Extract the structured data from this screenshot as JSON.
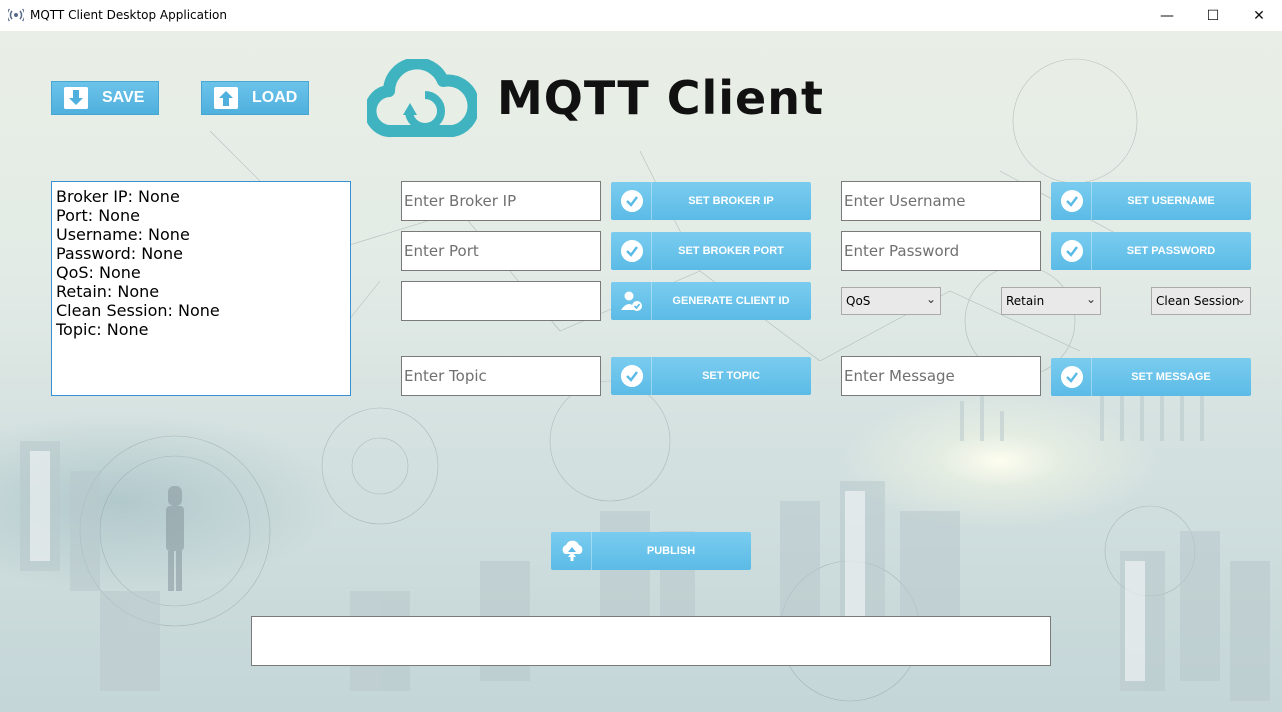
{
  "window": {
    "title": "MQTT Client Desktop Application",
    "minimize": "—",
    "maximize": "☐",
    "close": "✕"
  },
  "header": {
    "save_label": "SAVE",
    "load_label": "LOAD",
    "logo_text": "MQTT Client"
  },
  "status": {
    "lines": [
      "Broker IP: None",
      "Port: None",
      "Username: None",
      "Password: None",
      "QoS: None",
      "Retain: None",
      "Clean Session: None",
      "Topic: None"
    ]
  },
  "form": {
    "broker_ip_placeholder": "Enter Broker IP",
    "set_broker_ip": "SET BROKER IP",
    "port_placeholder": "Enter Port",
    "set_broker_port": "SET BROKER PORT",
    "client_id_value": "",
    "generate_client_id": "GENERATE CLIENT ID",
    "topic_placeholder": "Enter Topic",
    "set_topic": "SET TOPIC",
    "username_placeholder": "Enter Username",
    "set_username": "SET USERNAME",
    "password_placeholder": "Enter Password",
    "set_password": "SET PASSWORD",
    "qos_selected": "QoS",
    "retain_selected": "Retain",
    "clean_session_selected": "Clean Session",
    "message_placeholder": "Enter Message",
    "set_message": "SET MESSAGE",
    "publish": "PUBLISH",
    "output_value": ""
  },
  "colors": {
    "button_blue": "#5bbbe6",
    "logo_teal": "#3fb3bf"
  }
}
